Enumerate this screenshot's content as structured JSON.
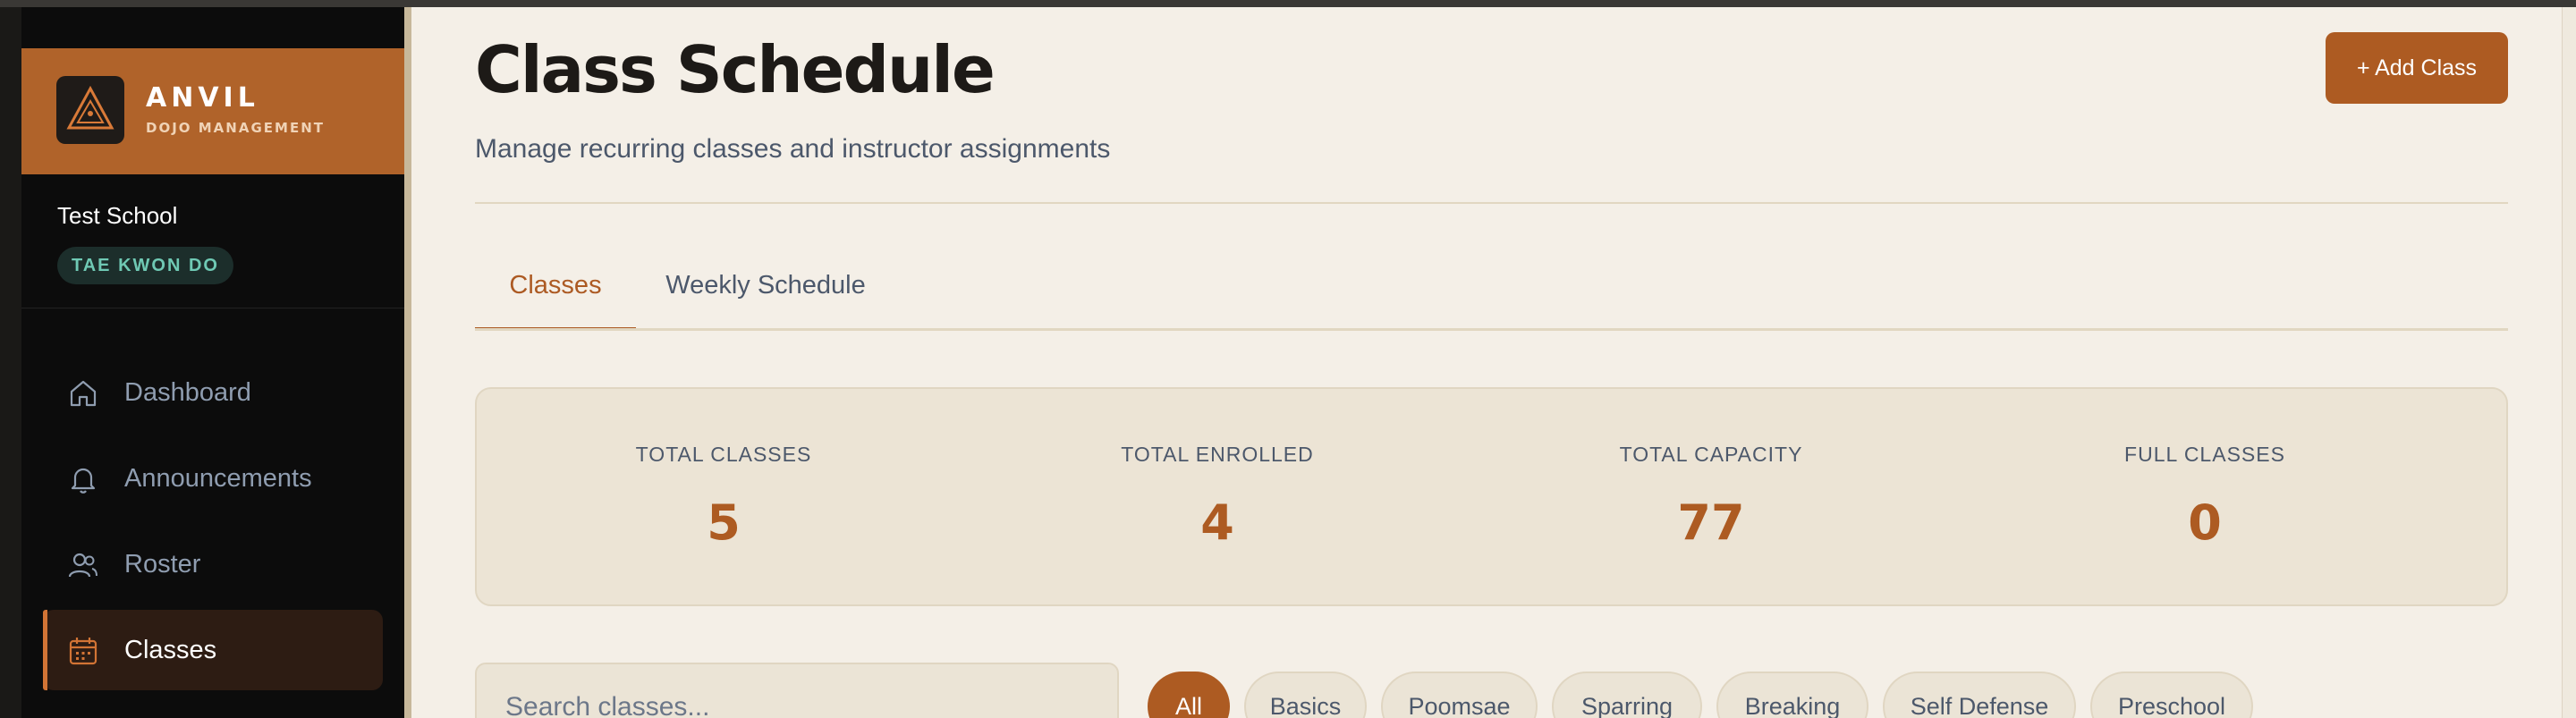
{
  "brand": {
    "name": "ANVIL",
    "subtitle": "DOJO MANAGEMENT"
  },
  "school": {
    "name": "Test School",
    "badge": "TAE KWON DO"
  },
  "nav": [
    {
      "label": "Dashboard",
      "icon": "home-icon"
    },
    {
      "label": "Announcements",
      "icon": "bell-icon"
    },
    {
      "label": "Roster",
      "icon": "users-icon"
    },
    {
      "label": "Classes",
      "icon": "calendar-icon",
      "active": true
    }
  ],
  "header": {
    "title": "Class Schedule",
    "subtitle": "Manage recurring classes and instructor assignments",
    "add_button": "+ Add Class"
  },
  "tabs": [
    {
      "label": "Classes",
      "active": true
    },
    {
      "label": "Weekly Schedule",
      "active": false
    }
  ],
  "stats": [
    {
      "label": "TOTAL CLASSES",
      "value": "5"
    },
    {
      "label": "TOTAL ENROLLED",
      "value": "4"
    },
    {
      "label": "TOTAL CAPACITY",
      "value": "77"
    },
    {
      "label": "FULL CLASSES",
      "value": "0"
    }
  ],
  "search": {
    "placeholder": "Search classes...",
    "value": ""
  },
  "filters": [
    "All",
    "Basics",
    "Poomsae",
    "Sparring",
    "Breaking",
    "Self Defense",
    "Preschool"
  ],
  "colors": {
    "accent": "#ad5b22",
    "brand": "#b0632a",
    "sidebar": "#0c0c0c",
    "background": "#f4efe7"
  }
}
